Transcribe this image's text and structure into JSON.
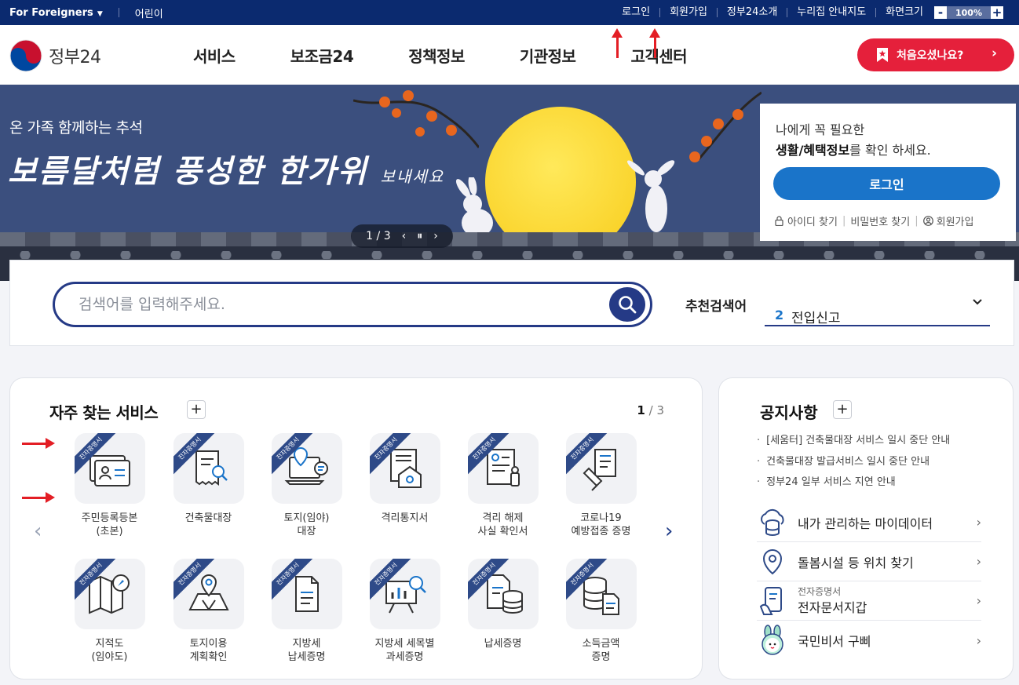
{
  "topbar": {
    "foreigners": "For Foreigners",
    "kids": "어린이",
    "links": [
      "로그인",
      "회원가입",
      "정부24소개",
      "누리집 안내지도",
      "화면크기"
    ],
    "zoom_minus": "-",
    "zoom_value": "100%",
    "zoom_plus": "+"
  },
  "header": {
    "logo_text": "정부24",
    "nav": [
      "서비스",
      "보조금24",
      "정책정보",
      "기관정보",
      "고객센터"
    ],
    "first_visit": "처음오셨나요?"
  },
  "hero": {
    "eyebrow": "온 가족 함께하는 추석",
    "script_main": "보름달처럼 풍성한 한가위",
    "script_tail": "보내세요",
    "pager": "1 / 3"
  },
  "login_card": {
    "line1": "나에게 꼭 필요한",
    "line2_bold": "생활/혜택정보",
    "line2_rest": "를 확인 하세요.",
    "button": "로그인",
    "find_id": "아이디 찾기",
    "find_pw": "비밀번호 찾기",
    "signup": "회원가입"
  },
  "search": {
    "placeholder": "검색어를 입력해주세요.",
    "recommend_label": "추천검색어",
    "recommend_num": "2",
    "recommend_keyword": "전입신고"
  },
  "favorites": {
    "title": "자주 찾는 서비스",
    "plus": "+",
    "page_current": "1",
    "page_total": " / 3",
    "ribbon": "전자증명서",
    "items": [
      {
        "label": "주민등록등본\n(초본)",
        "icon": "id-card-icon"
      },
      {
        "label": "건축물대장",
        "icon": "document-search-icon"
      },
      {
        "label": "토지(임야)\n대장",
        "icon": "land-laptop-icon"
      },
      {
        "label": "격리통지서",
        "icon": "quarantine-notice-icon"
      },
      {
        "label": "격리 해제\n사실 확인서",
        "icon": "quarantine-release-icon"
      },
      {
        "label": "코로나19\n예방접종 증명",
        "icon": "vaccine-icon"
      },
      {
        "label": "지적도\n(임야도)",
        "icon": "map-compass-icon"
      },
      {
        "label": "토지이용\n계획확인",
        "icon": "land-plan-icon"
      },
      {
        "label": "지방세\n납세증명",
        "icon": "tax-document-icon"
      },
      {
        "label": "지방세 세목별\n과세증명",
        "icon": "tax-chart-icon"
      },
      {
        "label": "납세증명",
        "icon": "tax-coins-icon"
      },
      {
        "label": "소득금액\n증명",
        "icon": "income-coins-icon"
      }
    ]
  },
  "notice": {
    "title": "공지사항",
    "plus": "+",
    "items": [
      "[세움터] 건축물대장 서비스 일시 중단 안내",
      "건축물대장 발급서비스 일시 중단 안내",
      "정부24 일부 서비스 지연 안내"
    ],
    "quick": [
      {
        "sub": "",
        "label": "내가 관리하는 마이데이터",
        "icon": "cloud-database-icon"
      },
      {
        "sub": "",
        "label": "돌봄시설 등 위치 찾기",
        "icon": "location-pin-icon"
      },
      {
        "sub": "전자증명서",
        "label": "전자문서지갑",
        "icon": "phone-wallet-icon"
      },
      {
        "sub": "",
        "label": "국민비서 구삐",
        "icon": "rabbit-mascot-icon"
      }
    ]
  },
  "colors": {
    "navy": "#0b2a6f",
    "search_navy": "#253a86",
    "login_blue": "#1a74c9",
    "cta_red": "#e5203b",
    "hero_bg": "#3b4f7e",
    "moon": "#f8cc1b"
  }
}
